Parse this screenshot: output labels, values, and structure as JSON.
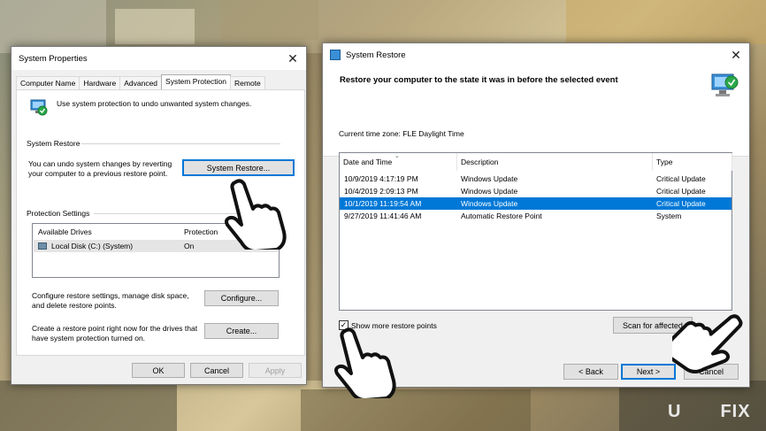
{
  "system_properties": {
    "title": "System Properties",
    "close": "✕",
    "tabs": [
      "Computer Name",
      "Hardware",
      "Advanced",
      "System Protection",
      "Remote"
    ],
    "intro": "Use system protection to undo unwanted system changes.",
    "restore_group": "System Restore",
    "restore_text_1": "You can undo system changes by reverting",
    "restore_text_2": "your computer to a previous restore point.",
    "restore_button": "System Restore...",
    "protection_group": "Protection Settings",
    "col_drives": "Available Drives",
    "col_protection": "Protection",
    "drive_name": "Local Disk (C:) (System)",
    "drive_protection": "On",
    "configure_text_1": "Configure restore settings, manage disk space,",
    "configure_text_2": "and delete restore points.",
    "configure_button": "Configure...",
    "create_text_1": "Create a restore point right now for the drives that",
    "create_text_2": "have system protection turned on.",
    "create_button": "Create...",
    "ok_button": "OK",
    "cancel_button": "Cancel",
    "apply_button": "Apply"
  },
  "system_restore": {
    "title": "System Restore",
    "close": "✕",
    "heading": "Restore your computer to the state it was in before the selected event",
    "timezone": "Current time zone: FLE Daylight Time",
    "columns": [
      "Date and Time",
      "Description",
      "Type"
    ],
    "rows": [
      {
        "date": "10/9/2019 4:17:19 PM",
        "desc": "Windows Update",
        "type": "Critical Update"
      },
      {
        "date": "10/4/2019 2:09:13 PM",
        "desc": "Windows Update",
        "type": "Critical Update"
      },
      {
        "date": "10/1/2019 11:19:54 AM",
        "desc": "Windows Update",
        "type": "Critical Update"
      },
      {
        "date": "9/27/2019 11:41:46 AM",
        "desc": "Automatic Restore Point",
        "type": "System"
      }
    ],
    "selected_row": 2,
    "show_more_label": "Show more restore points",
    "show_more_checked": "✓",
    "scan_button": "Scan for affected",
    "back_button": "< Back",
    "next_button": "Next >",
    "cancel_button": "Cancel"
  },
  "watermark": {
    "left": "U",
    "right": "FIX"
  },
  "colors": {
    "accent": "#0078d7",
    "window_bg": "#f0f0f0"
  }
}
